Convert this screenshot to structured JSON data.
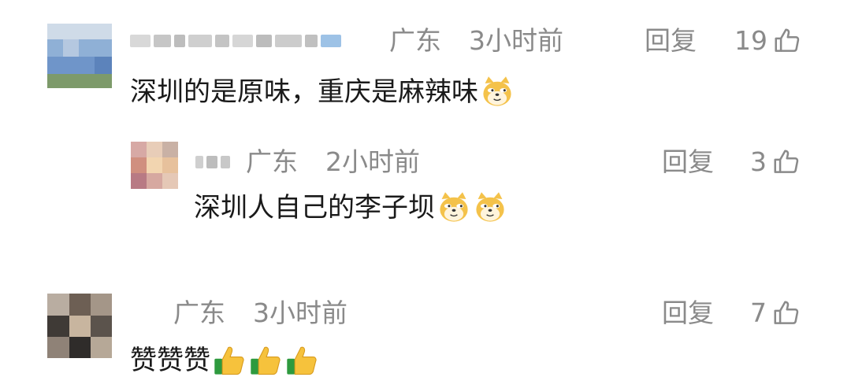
{
  "comments": [
    {
      "location": "广东",
      "time": "3小时前",
      "text": "深圳的是原味，重庆是麻辣味",
      "emojis": [
        "doge-emoji"
      ],
      "reply_label": "回复",
      "likes": "19"
    },
    {
      "location": "广东",
      "time": "2小时前",
      "text": "深圳人自己的李子坝",
      "emojis": [
        "doge-emoji",
        "doge-emoji"
      ],
      "reply_label": "回复",
      "likes": "3"
    },
    {
      "location": "广东",
      "time": "3小时前",
      "text": "赞赞赞",
      "emojis": [
        "thumbs-up-emoji",
        "thumbs-up-emoji",
        "thumbs-up-emoji"
      ],
      "reply_label": "回复",
      "likes": "7"
    }
  ],
  "colors": {
    "meta": "#8a8a8a",
    "text": "#1a1a1a",
    "background": "#ffffff"
  }
}
